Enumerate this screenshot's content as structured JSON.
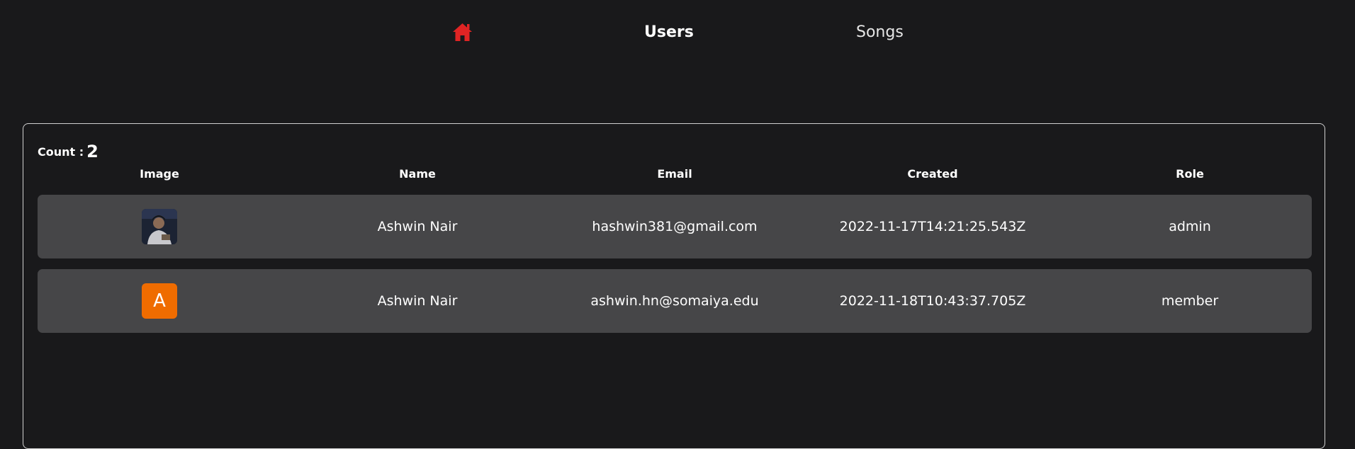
{
  "nav": {
    "home_icon": "home-icon",
    "home_color": "#e02424",
    "links": [
      {
        "label": "Users"
      },
      {
        "label": "Songs"
      }
    ]
  },
  "table": {
    "count_label": "Count :",
    "count_value": "2",
    "headers": [
      "Image",
      "Name",
      "Email",
      "Created",
      "Role"
    ],
    "rows": [
      {
        "image": "profile-photo",
        "name": "Ashwin Nair",
        "email": "hashwin381@gmail.com",
        "created": "2022-11-17T14:21:25.543Z",
        "role": "admin"
      },
      {
        "image": "letter-avatar",
        "avatar_letter": "A",
        "avatar_color": "#ef6c00",
        "name": "Ashwin Nair",
        "email": "ashwin.hn@somaiya.edu",
        "created": "2022-11-18T10:43:37.705Z",
        "role": "member"
      }
    ]
  }
}
